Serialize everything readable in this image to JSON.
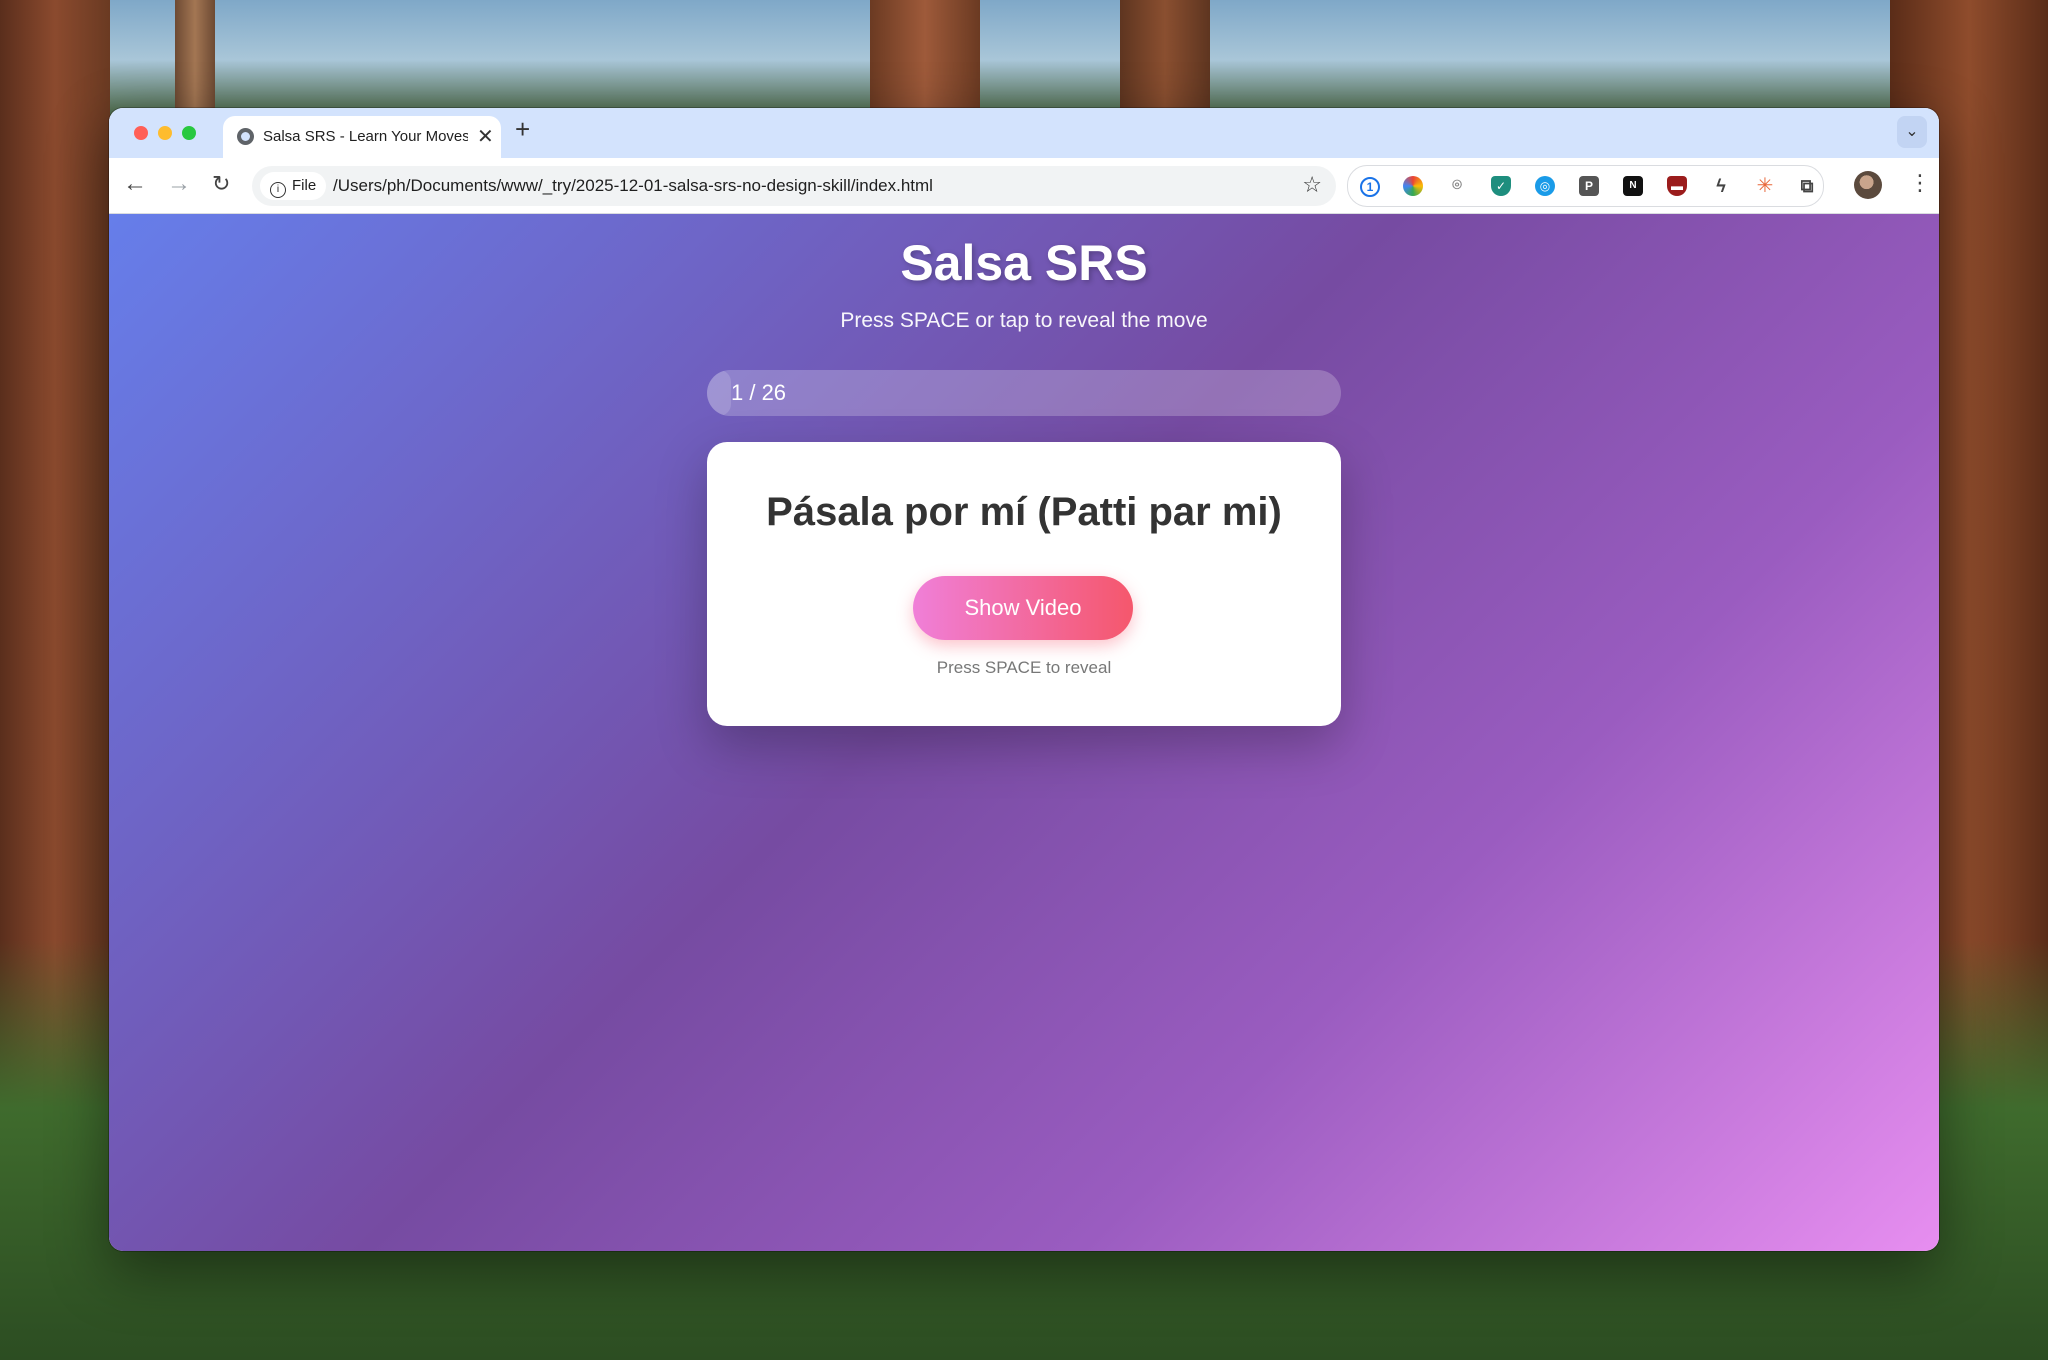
{
  "browser": {
    "tab_title": "Salsa SRS - Learn Your Moves",
    "url_chip": "File",
    "url": "/Users/ph/Documents/www/_try/2025-12-01-salsa-srs-no-design-skill/index.html",
    "extensions": [
      "1password-icon",
      "color-wheel-icon",
      "camera-icon",
      "shield-check-icon",
      "globe-blue-icon",
      "p-icon",
      "notion-icon",
      "ublock-shield-icon",
      "bolt-icon",
      "asterisk-icon",
      "puzzle-icon"
    ]
  },
  "app": {
    "title": "Salsa SRS",
    "subtitle": "Press SPACE or tap to reveal the move",
    "progress_text": "1 / 26",
    "progress_fraction": 0.0385,
    "move_name": "Pásala por mí (Patti par mi)",
    "show_button": "Show Video",
    "hint": "Press SPACE to reveal"
  },
  "colors": {
    "gradient_start": "#667eea",
    "gradient_mid": "#764ba2",
    "gradient_end": "#e78ef0",
    "button_start": "#f07fd8",
    "button_end": "#f5576c"
  }
}
